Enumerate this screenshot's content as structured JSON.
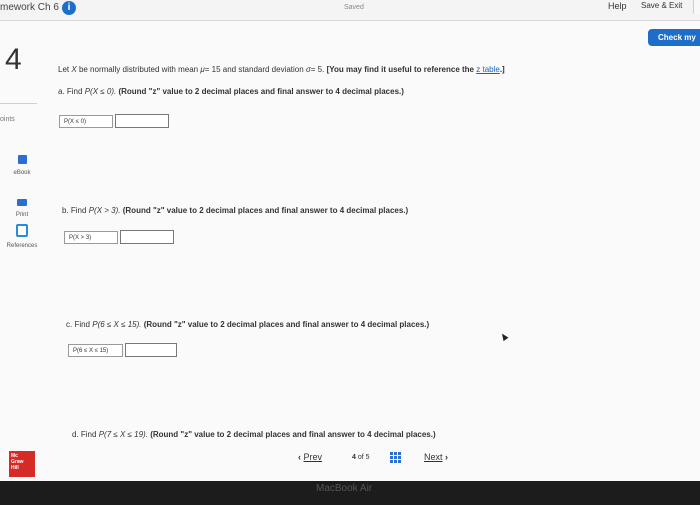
{
  "header": {
    "title": "mework Ch 6",
    "info_icon": "i",
    "status": "Saved",
    "help": "Help",
    "save_exit": "Save & Exit"
  },
  "check_button": {
    "label": "Check my"
  },
  "question": {
    "number": "4",
    "points_label": "oints",
    "intro": {
      "lead": "Let",
      "var": "X",
      "mid": "be normally distributed with mean",
      "mu": "μ",
      "mu_val": "= 15 and standard deviation",
      "sigma": "σ",
      "sigma_val": "= 5.",
      "bold_part": "[You may find it useful to reference the",
      "link": "z table",
      "bold_end": ".]"
    },
    "parts": [
      {
        "label": "a. Find",
        "expr": "P(X ≤ 0).",
        "instruction": "(Round \"z\" value to 2 decimal places and final answer to 4 decimal places.)",
        "prompt": "P(X ≤ 0)",
        "value": ""
      },
      {
        "label": "b. Find",
        "expr": "P(X > 3).",
        "instruction": "(Round \"z\" value to 2 decimal places and final answer to 4 decimal places.)",
        "prompt": "P(X > 3)",
        "value": ""
      },
      {
        "label": "c. Find",
        "expr": "P(6 ≤ X ≤ 15).",
        "instruction": "(Round \"z\" value to 2 decimal places and final answer to 4 decimal places.)",
        "prompt": "P(6 ≤ X ≤ 15)",
        "value": ""
      },
      {
        "label": "d. Find",
        "expr": "P(7 ≤ X ≤ 19).",
        "instruction": "(Round \"z\" value to 2 decimal places and final answer to 4 decimal places.)"
      }
    ]
  },
  "sidebar": {
    "tools": [
      {
        "label": "eBook",
        "icon": "ebook-icon"
      },
      {
        "label": "Print",
        "icon": "print-icon"
      },
      {
        "label": "References",
        "icon": "references-icon"
      }
    ]
  },
  "logo": {
    "lines": [
      "Mc",
      "Graw",
      "Hill"
    ]
  },
  "navigation": {
    "prev": "Prev",
    "prev_icon": "‹",
    "page_current": "4",
    "page_of": "of",
    "page_total": "5",
    "next": "Next",
    "next_icon": "›"
  },
  "bottom": {
    "device_label": "MacBook Air"
  }
}
